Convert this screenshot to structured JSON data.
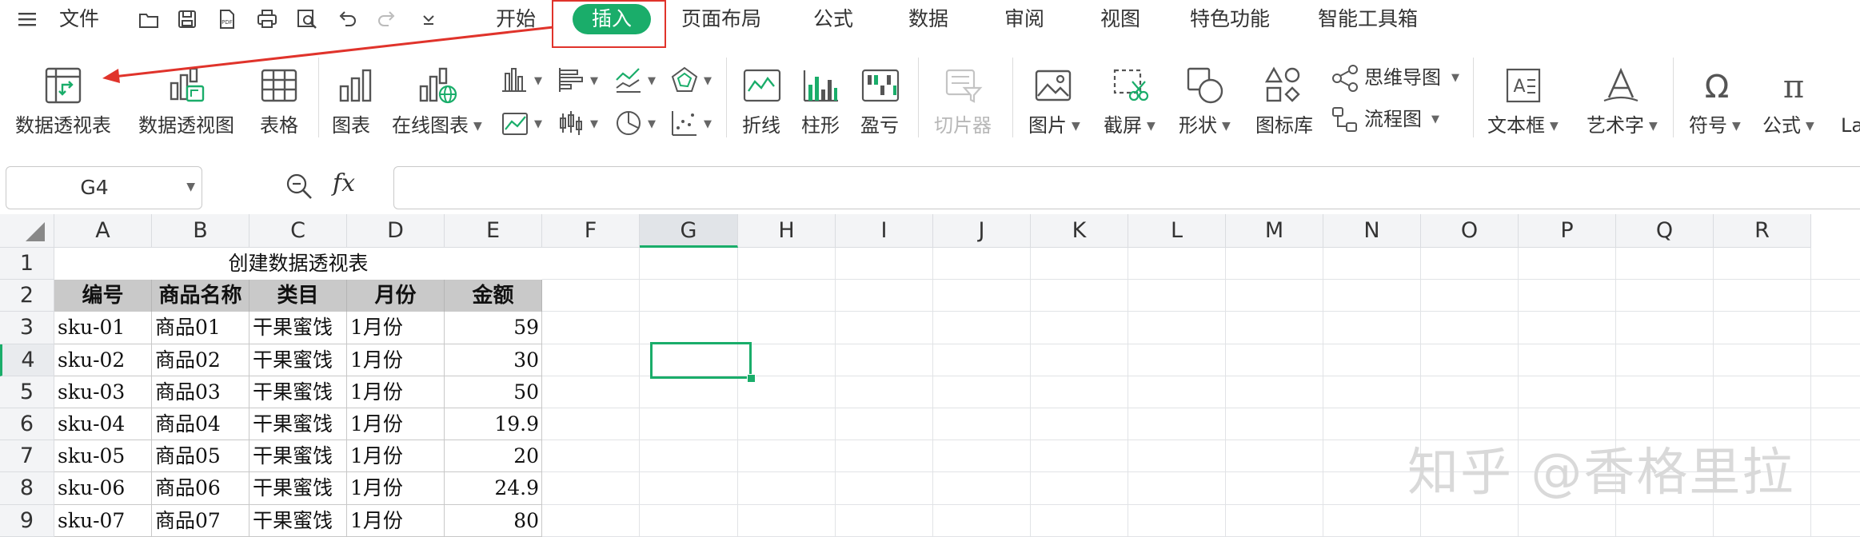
{
  "menu": {
    "file_label": "文件",
    "tabs": [
      {
        "label": "开始"
      },
      {
        "label": "插入"
      },
      {
        "label": "页面布局"
      },
      {
        "label": "公式"
      },
      {
        "label": "数据"
      },
      {
        "label": "审阅"
      },
      {
        "label": "视图"
      },
      {
        "label": "特色功能"
      },
      {
        "label": "智能工具箱"
      }
    ],
    "quick_access_icons": [
      "open-folder-icon",
      "save-icon",
      "export-pdf-icon",
      "print-icon",
      "print-preview-icon",
      "undo-icon",
      "redo-icon",
      "customize-dropdown-icon"
    ],
    "pdf_text": "PDF",
    "active_tab": "插入",
    "accent_color": "#1aad6a",
    "highlight_color": "#e0332b"
  },
  "ribbon": {
    "pivot_table": "数据透视表",
    "pivot_chart": "数据透视图",
    "table": "表格",
    "chart": "图表",
    "online_chart": "在线图表",
    "sparkline_line": "折线",
    "sparkline_column": "柱形",
    "sparkline_winloss": "盈亏",
    "slicer": "切片器",
    "picture": "图片",
    "screenshot": "截屏",
    "shape": "形状",
    "icon_library": "图标库",
    "mind_map": "思维导图",
    "flowchart": "流程图",
    "text_box": "文本框",
    "word_art": "艺术字",
    "symbol": "符号",
    "formula": "公式",
    "truncated": "La"
  },
  "formula_bar": {
    "name_box": "G4",
    "fx": "fx",
    "formula": ""
  },
  "sheet": {
    "columns": [
      "A",
      "B",
      "C",
      "D",
      "E",
      "F",
      "G",
      "H",
      "I",
      "J",
      "K",
      "L",
      "M",
      "N",
      "O",
      "P",
      "Q",
      "R"
    ],
    "rows": [
      "1",
      "2",
      "3",
      "4",
      "5",
      "6",
      "7",
      "8",
      "9"
    ],
    "active_cell": "G4",
    "title": "创建数据透视表",
    "headers": [
      "编号",
      "商品名称",
      "类目",
      "月份",
      "金额"
    ],
    "data": [
      [
        "sku-01",
        "商品01",
        "干果蜜饯",
        "1月份",
        "59"
      ],
      [
        "sku-02",
        "商品02",
        "干果蜜饯",
        "1月份",
        "30"
      ],
      [
        "sku-03",
        "商品03",
        "干果蜜饯",
        "1月份",
        "50"
      ],
      [
        "sku-04",
        "商品04",
        "干果蜜饯",
        "1月份",
        "19.9"
      ],
      [
        "sku-05",
        "商品05",
        "干果蜜饯",
        "1月份",
        "20"
      ],
      [
        "sku-06",
        "商品06",
        "干果蜜饯",
        "1月份",
        "24.9"
      ],
      [
        "sku-07",
        "商品07",
        "干果蜜饯",
        "1月份",
        "80"
      ]
    ]
  },
  "watermark": "知乎 @香格里拉"
}
